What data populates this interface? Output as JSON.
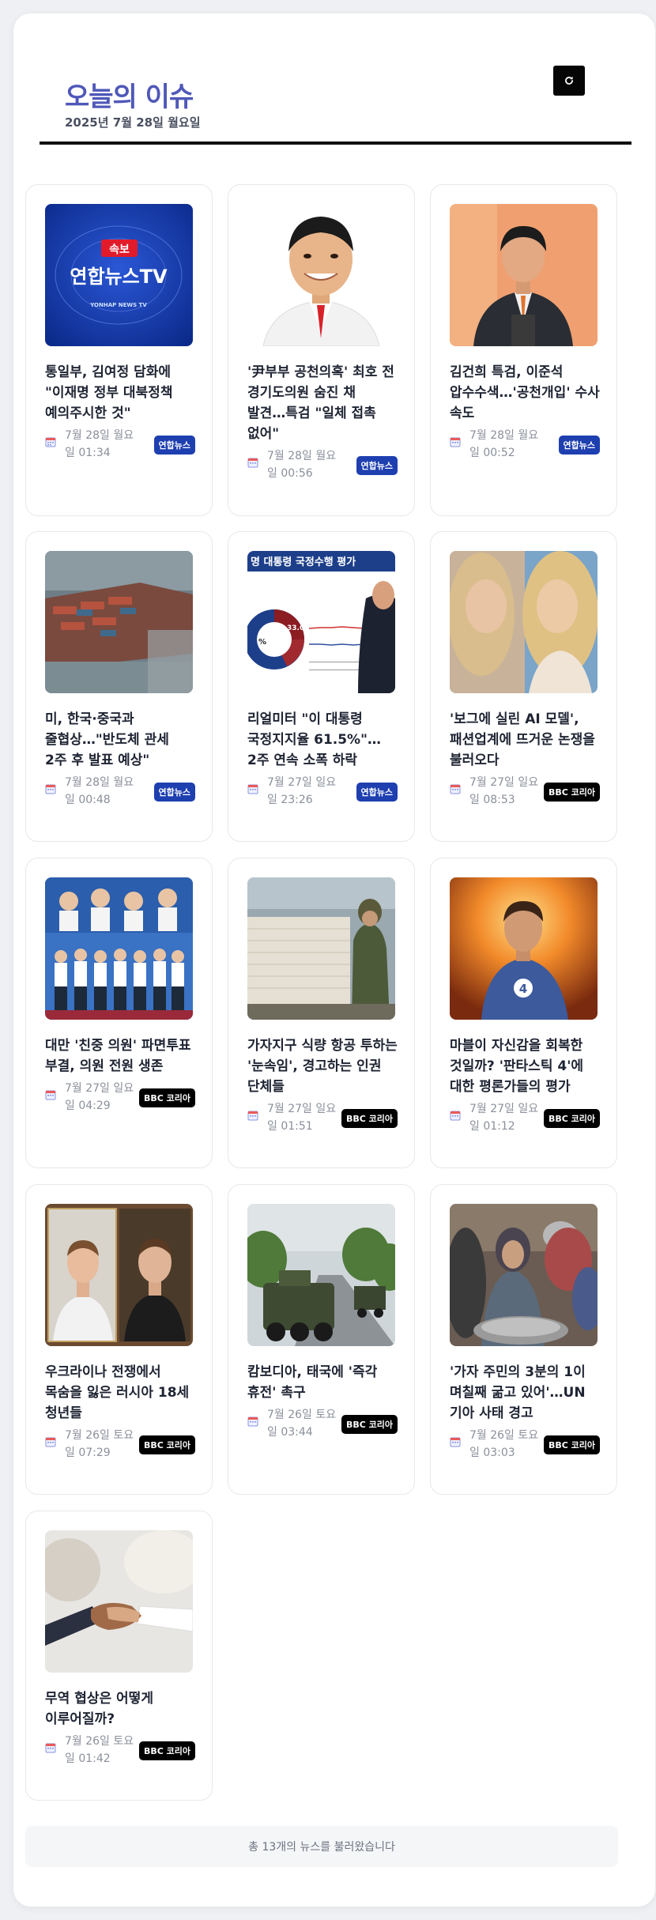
{
  "header": {
    "title": "오늘의 이슈",
    "date": "2025년 7월 28일 월요일",
    "refresh_icon": "refresh-icon"
  },
  "colors": {
    "title": "#4f58b8",
    "yonhap_badge": "#1e3fb0",
    "bbc_badge": "#000000"
  },
  "thumb_text": {
    "yonhap_flash": "속보",
    "yonhap_logo": "연합뉴스TV",
    "yonhap_sub": "YONHAP NEWS TV",
    "poll_title": "명 대통령 국정수행 평가",
    "poll_value": "33.0",
    "poll_pct": "%"
  },
  "news": [
    {
      "headline": "통일부, 김여정 담화에 \"이재명 정부 대북정책 예의주시한 것\"",
      "time": "7월 28일 월요일 01:34",
      "source": "연합뉴스"
    },
    {
      "headline": "'尹부부 공천의혹' 최호 전 경기도의원 숨진 채 발견…특검 \"일체 접촉 없어\"",
      "time": "7월 28일 월요일 00:56",
      "source": "연합뉴스"
    },
    {
      "headline": "김건희 특검, 이준석 압수수색…'공천개입' 수사 속도",
      "time": "7월 28일 월요일 00:52",
      "source": "연합뉴스"
    },
    {
      "headline": "미, 한국·중국과 줄협상…\"반도체 관세 2주 후 발표 예상\"",
      "time": "7월 28일 월요일 00:48",
      "source": "연합뉴스"
    },
    {
      "headline": "리얼미터 \"이 대통령 국정지지율 61.5%\"…2주 연속 소폭 하락",
      "time": "7월 27일 일요일 23:26",
      "source": "연합뉴스"
    },
    {
      "headline": "'보그에 실린 AI 모델', 패션업계에 뜨거운 논쟁을 불러오다",
      "time": "7월 27일 일요일 08:53",
      "source": "BBC 코리아"
    },
    {
      "headline": "대만 '친중 의원' 파면투표 부결, 의원 전원 생존",
      "time": "7월 27일 일요일 04:29",
      "source": "BBC 코리아"
    },
    {
      "headline": "가자지구 식량 항공 투하는 '눈속임', 경고하는 인권 단체들",
      "time": "7월 27일 일요일 01:51",
      "source": "BBC 코리아"
    },
    {
      "headline": "마블이 자신감을 회복한 것일까? '판타스틱 4'에 대한 평론가들의 평가",
      "time": "7월 27일 일요일 01:12",
      "source": "BBC 코리아"
    },
    {
      "headline": "우크라이나 전쟁에서 목숨을 잃은 러시아 18세 청년들",
      "time": "7월 26일 토요일 07:29",
      "source": "BBC 코리아"
    },
    {
      "headline": "캄보디아, 태국에 '즉각 휴전' 촉구",
      "time": "7월 26일 토요일 03:44",
      "source": "BBC 코리아"
    },
    {
      "headline": "'가자 주민의 3분의 1이 며칠째 굶고 있어'…UN 기아 사태 경고",
      "time": "7월 26일 토요일 03:03",
      "source": "BBC 코리아"
    },
    {
      "headline": "무역 협상은 어떻게 이루어질까?",
      "time": "7월 26일 토요일 01:42",
      "source": "BBC 코리아"
    }
  ],
  "footer": {
    "text": "총 13개의 뉴스를 불러왔습니다"
  }
}
